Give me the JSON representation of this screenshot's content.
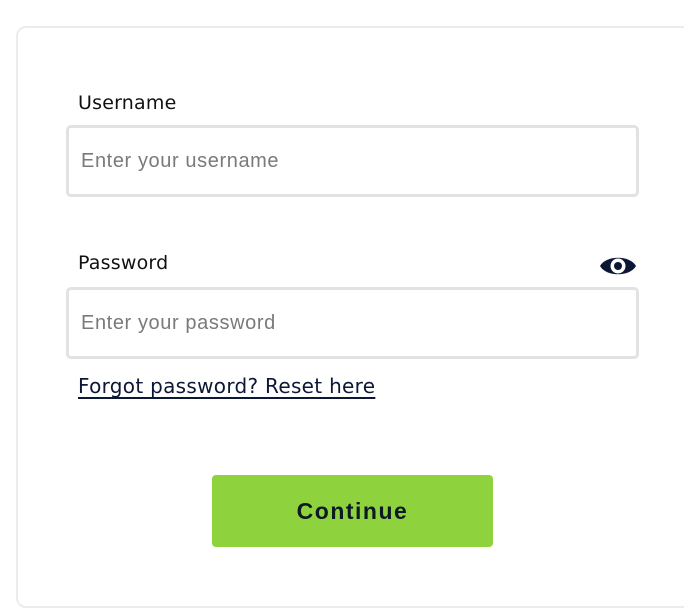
{
  "form": {
    "username": {
      "label": "Username",
      "value": "",
      "placeholder": "Enter your username"
    },
    "password": {
      "label": "Password",
      "value": "",
      "placeholder": "Enter your password",
      "toggle_icon": "eye-icon"
    },
    "forgot_link": "Forgot password? Reset here",
    "continue_label": "Continue"
  },
  "colors": {
    "accent_button": "#8ED33E",
    "link": "#0C1736",
    "icon": "#0C1736",
    "border": "#E2E2E2"
  }
}
